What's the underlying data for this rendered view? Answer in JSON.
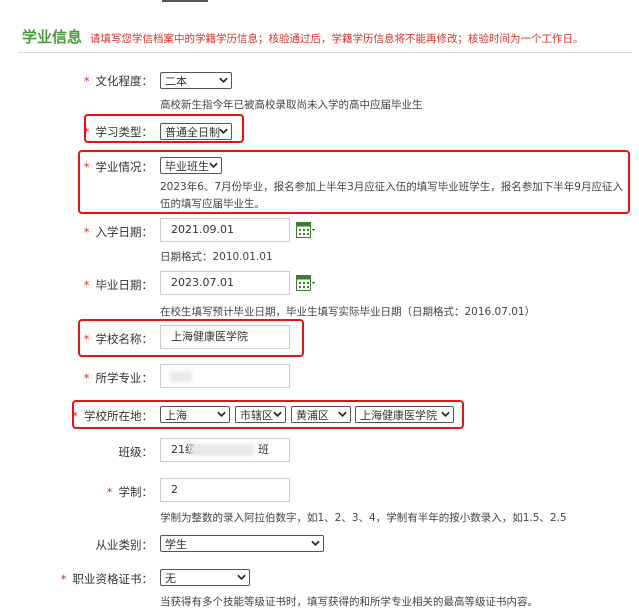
{
  "section": {
    "title": "学业信息",
    "note": "请填写您学信档案中的学籍学历信息；核验通过后，学籍学历信息将不能再修改；核验时间为一个工作日。"
  },
  "fields": {
    "culture": {
      "label": "文化程度：",
      "value": "二本",
      "hint": "高校新生指今年已被高校录取尚未入学的高中应届毕业生"
    },
    "study_type": {
      "label": "学习类型：",
      "value": "普通全日制"
    },
    "study_status": {
      "label": "学业情况：",
      "value": "毕业班生",
      "hint": "2023年6、7月份毕业，报名参加上半年3月应征入伍的填写毕业班学生，报名参加下半年9月应征入伍的填写应届毕业生。"
    },
    "enroll_date": {
      "label": "入学日期：",
      "value": "2021.09.01",
      "hint": "日期格式：2010.01.01"
    },
    "grad_date": {
      "label": "毕业日期：",
      "value": "2023.07.01",
      "hint": "在校生填写预计毕业日期，毕业生填写实际毕业日期（日期格式：2016.07.01）"
    },
    "school_name": {
      "label": "学校名称：",
      "value": "上海健康医学院"
    },
    "major": {
      "label": "所学专业：",
      "value": ""
    },
    "school_location": {
      "label": "学校所在地：",
      "province": "上海",
      "city": "市辖区",
      "district": "黄浦区",
      "school": "上海健康医学院"
    },
    "class": {
      "label": "班级：",
      "value_prefix": "21级",
      "value_suffix": "班"
    },
    "duration": {
      "label": "学制：",
      "value": "2",
      "hint": "学制为整数的录入阿拉伯数字，如1、2、3、4，学制有半年的按小数录入，如1.5、2.5"
    },
    "occupation_type": {
      "label": "从业类别：",
      "value": "学生"
    },
    "certificate": {
      "label": "职业资格证书：",
      "value": "无",
      "hint": "当获得有多个技能等级证书时，填写获得的和所学专业相关的最高等级证书内容。"
    }
  },
  "required_mark": "*",
  "colors": {
    "accent_green": "#4a9b3f",
    "note_red": "#d9322b",
    "highlight_red": "#e11111"
  }
}
